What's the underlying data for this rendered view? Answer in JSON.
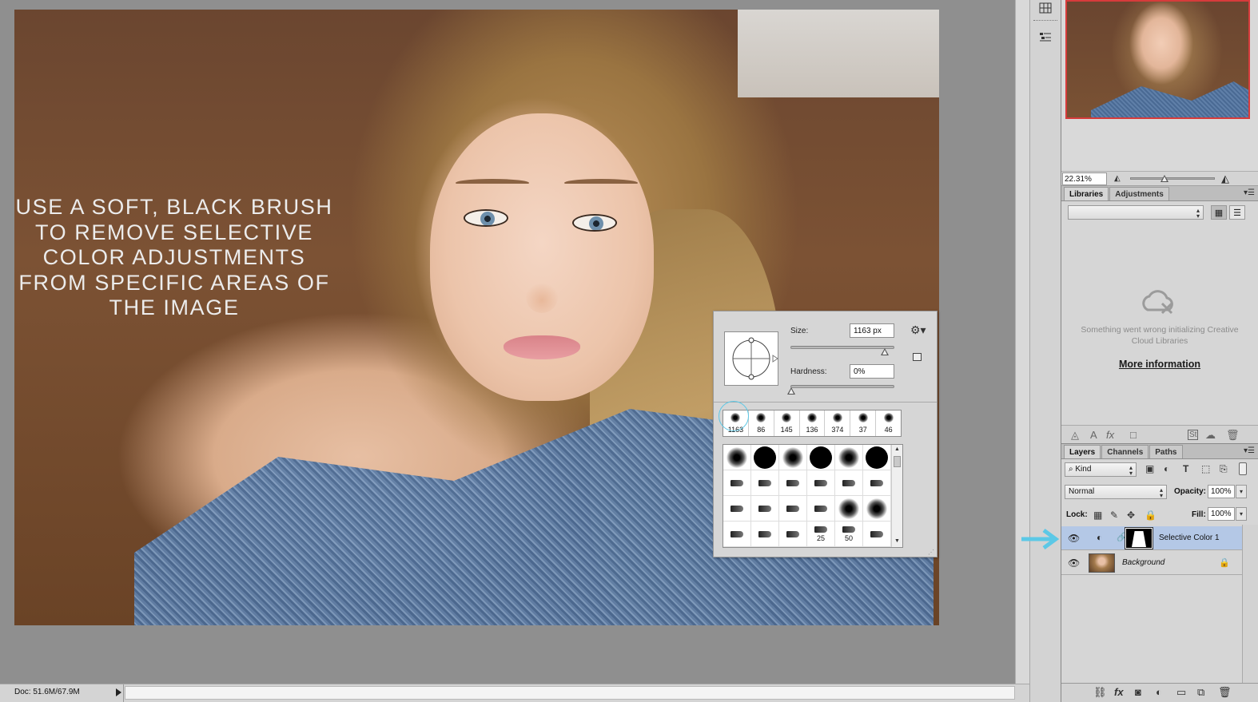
{
  "canvas": {
    "overlay_text": "USE A SOFT, BLACK BRUSH TO REMOVE SELECTIVE COLOR ADJUSTMENTS FROM SPECIFIC AREAS OF THE IMAGE"
  },
  "brush_picker": {
    "size_label": "Size:",
    "size_value": "1163 px",
    "size_level_fraction": 0.92,
    "hardness_label": "Hardness:",
    "hardness_value": "0%",
    "hardness_level_fraction": 0.0,
    "gear_icon": "gear-icon",
    "recent_sizes": [
      "1163",
      "86",
      "145",
      "136",
      "374",
      "37",
      "46"
    ],
    "preset_numbers": {
      "row4_col4": "25",
      "row4_col5": "50"
    }
  },
  "status_bar": {
    "doc_info": "Doc: 51.6M/67.9M"
  },
  "navigator": {
    "zoom": "22.31%"
  },
  "libraries_panel": {
    "tabs": [
      "Libraries",
      "Adjustments"
    ],
    "active_tab": "Libraries",
    "error_message": "Something went wrong initializing Creative Cloud Libraries",
    "more_info_link": "More information"
  },
  "layers_panel": {
    "tabs": [
      "Layers",
      "Channels",
      "Paths"
    ],
    "active_tab": "Layers",
    "filter_kind": "Kind",
    "blend_mode": "Normal",
    "opacity_label": "Opacity:",
    "opacity_value": "100%",
    "lock_label": "Lock:",
    "fill_label": "Fill:",
    "fill_value": "100%",
    "layers": [
      {
        "name": "Selective Color 1",
        "selected": true,
        "visible": true
      },
      {
        "name": "Background",
        "selected": false,
        "visible": true,
        "locked": true
      }
    ]
  },
  "colors": {
    "selection_highlight": "#b4c8e6",
    "annotation_arrow": "#5cc8e6",
    "navigator_frame": "#d63b3b"
  }
}
